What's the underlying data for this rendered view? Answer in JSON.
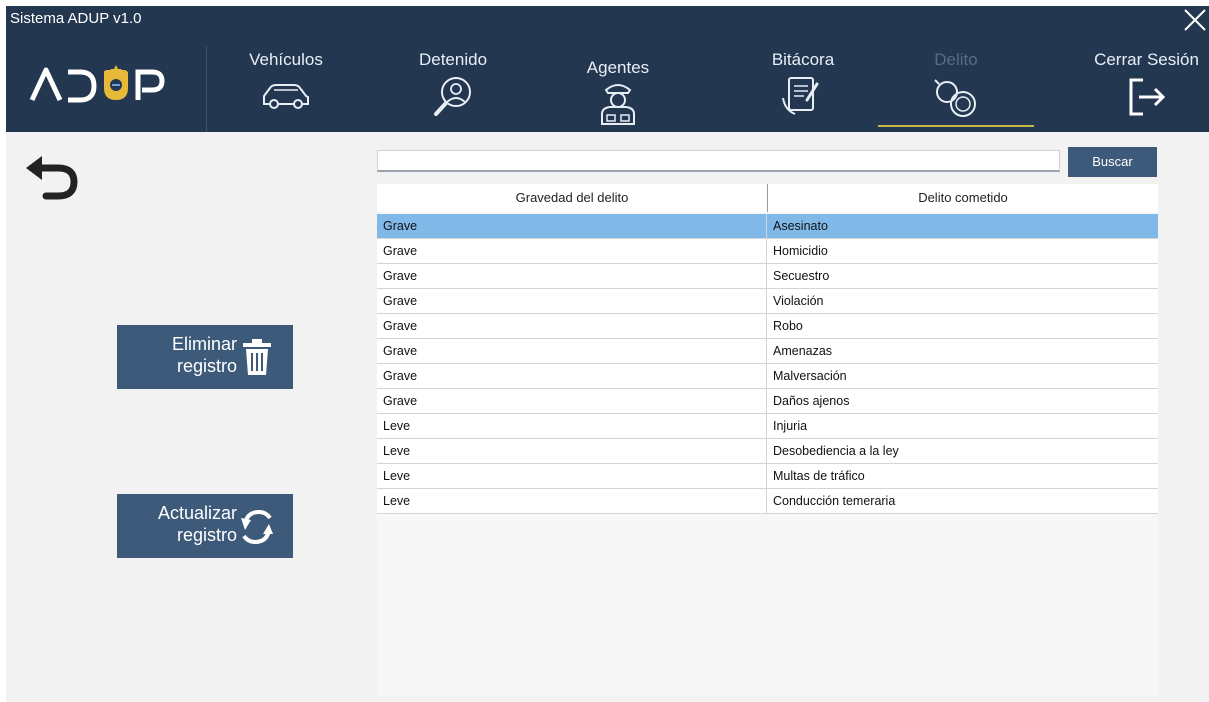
{
  "app": {
    "title": "Sistema ADUP v1.0"
  },
  "nav": {
    "items": [
      {
        "label": "Vehículos",
        "icon": "car-icon"
      },
      {
        "label": "Detenido",
        "icon": "detainee-magnifier-icon"
      },
      {
        "label": "Agentes",
        "icon": "police-agent-icon"
      },
      {
        "label": "Bitácora",
        "icon": "logbook-tablet-icon"
      },
      {
        "label": "Delito",
        "icon": "handcuffs-icon",
        "active": true
      },
      {
        "label": "Cerrar Sesión",
        "icon": "logout-icon"
      }
    ]
  },
  "actions": {
    "delete_line1": "Eliminar",
    "delete_line2": "registro",
    "update_line1": "Actualizar",
    "update_line2": "registro"
  },
  "search": {
    "value": "",
    "button_label": "Buscar"
  },
  "table": {
    "columns": [
      "Gravedad del delito",
      "Delito cometido"
    ],
    "rows": [
      {
        "gravedad": "Grave",
        "delito": "Asesinato",
        "selected": true
      },
      {
        "gravedad": "Grave",
        "delito": "Homicidio"
      },
      {
        "gravedad": "Grave",
        "delito": "Secuestro"
      },
      {
        "gravedad": "Grave",
        "delito": "Violación"
      },
      {
        "gravedad": "Grave",
        "delito": "Robo"
      },
      {
        "gravedad": "Grave",
        "delito": "Amenazas"
      },
      {
        "gravedad": "Grave",
        "delito": "Malversación"
      },
      {
        "gravedad": "Grave",
        "delito": "Daños ajenos"
      },
      {
        "gravedad": "Leve",
        "delito": "Injuria"
      },
      {
        "gravedad": "Leve",
        "delito": "Desobediencia a la ley"
      },
      {
        "gravedad": "Leve",
        "delito": "Multas de tráfico"
      },
      {
        "gravedad": "Leve",
        "delito": "Conducción temeraria"
      }
    ]
  },
  "colors": {
    "header_bg": "#233750",
    "button_bg": "#3d5a7a",
    "selection": "#80b9e8",
    "logo_gold": "#e8b838",
    "active_underline": "#c8b548"
  }
}
